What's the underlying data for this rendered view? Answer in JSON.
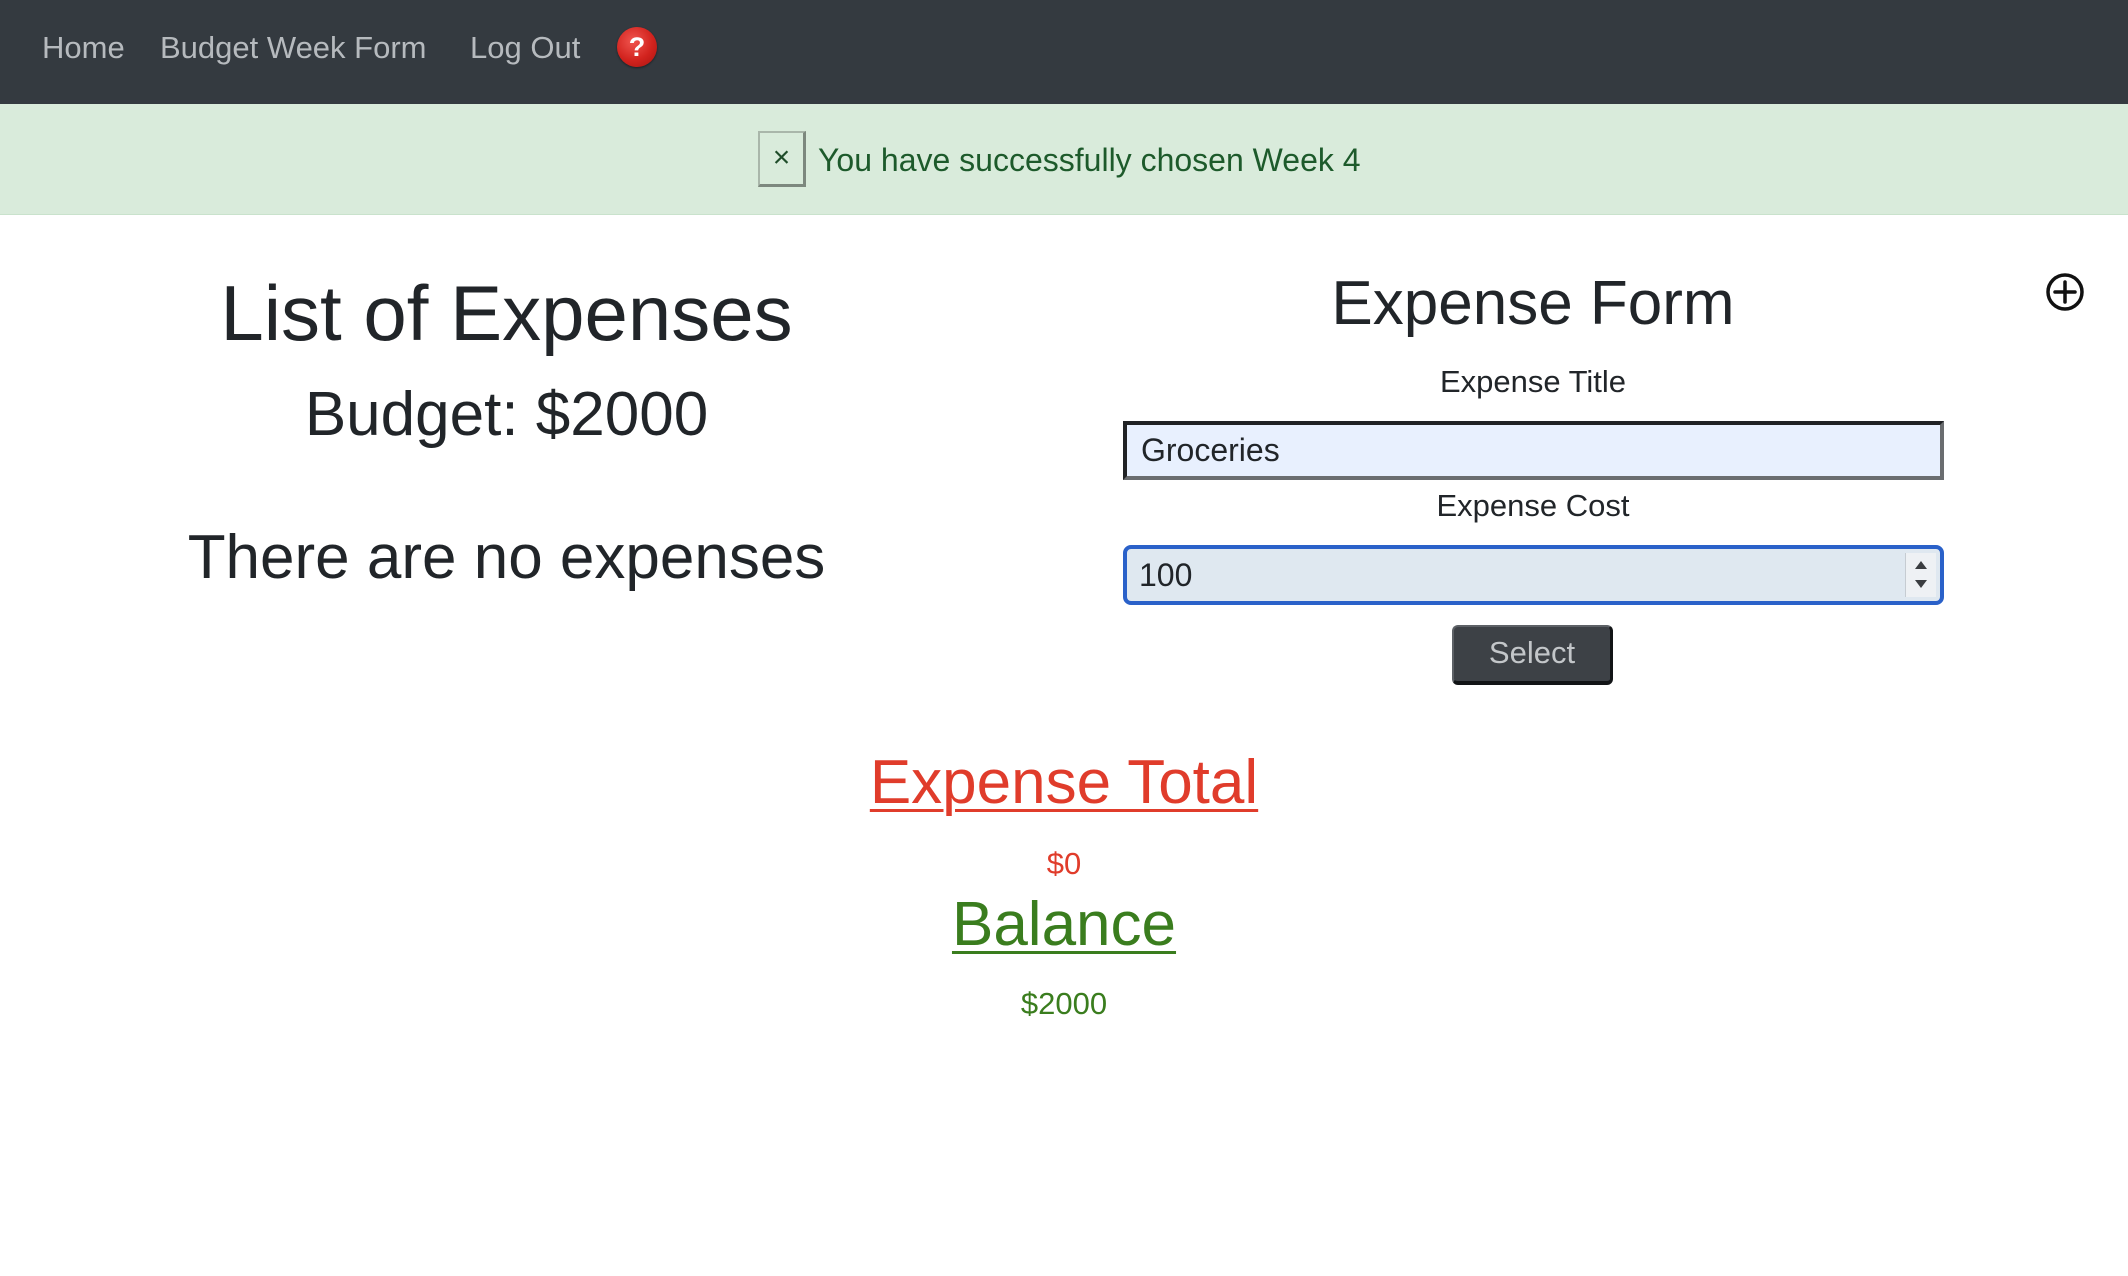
{
  "navbar": {
    "links": [
      {
        "label": "Home"
      },
      {
        "label": "Budget Week Form"
      },
      {
        "label": "Log Out"
      }
    ],
    "help_icon": {
      "icon": "question-circle-icon",
      "glyph": "?",
      "color": "#d2231e"
    }
  },
  "alert": {
    "close_label": "×",
    "message": "You have successfully chosen Week 4",
    "background": "#d9ebdb"
  },
  "expenses": {
    "title": "List of Expenses",
    "budget": "Budget: $2000",
    "empty_message": "There are no expenses"
  },
  "form": {
    "title": "Expense Form",
    "title_label": "Expense Title",
    "title_value": "Groceries",
    "cost_label": "Expense Cost",
    "cost_value": "100",
    "submit_label": "Select",
    "add_icon": "plus-circle-icon"
  },
  "totals": {
    "expense_total_label": "Expense Total",
    "expense_total_value": "$0",
    "expense_color": "#e03c2b",
    "balance_label": "Balance",
    "balance_value": "$2000",
    "balance_color": "#3a7d1e"
  }
}
